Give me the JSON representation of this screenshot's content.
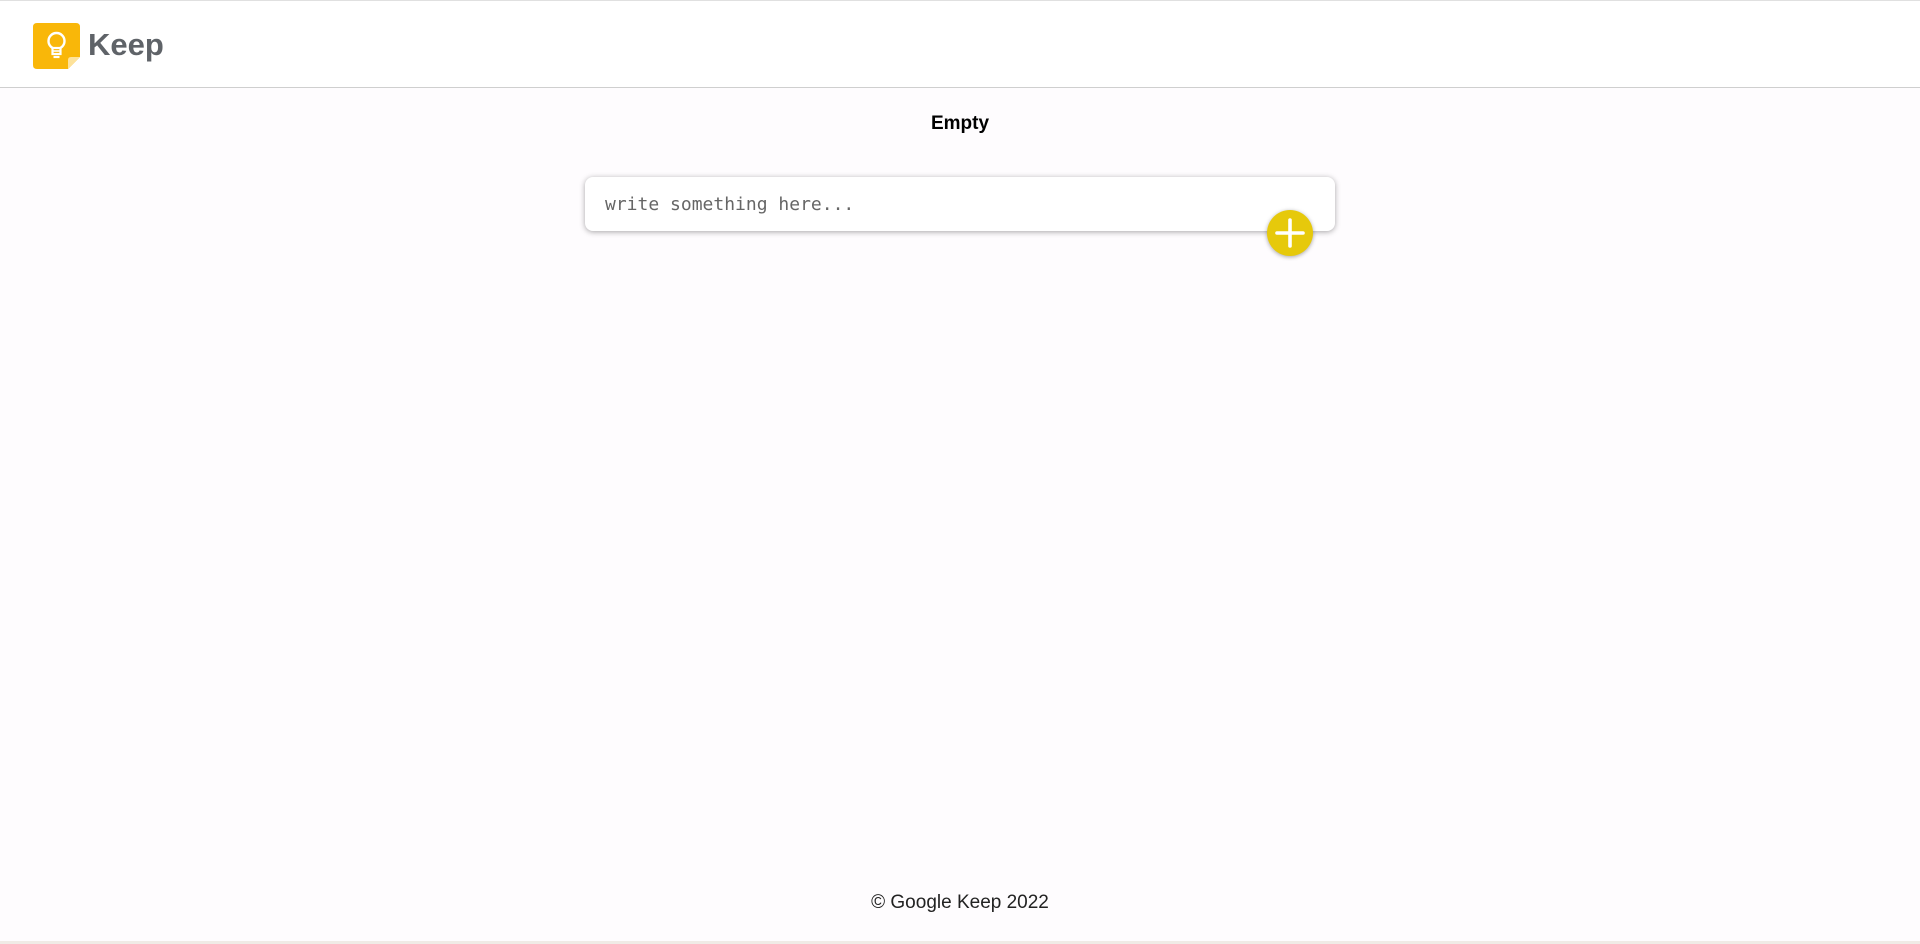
{
  "header": {
    "logo_icon": "lightbulb-note-icon",
    "title": "Keep"
  },
  "main": {
    "title": "Empty",
    "note_input": {
      "value": "",
      "placeholder": "write something here..."
    },
    "add_button_icon": "plus-icon"
  },
  "footer": {
    "text": "© Google Keep 2022"
  },
  "colors": {
    "brand_yellow": "#f9b709",
    "add_button": "#e6c90b",
    "logo_text": "#5f6368",
    "background": "#fefcfe"
  }
}
